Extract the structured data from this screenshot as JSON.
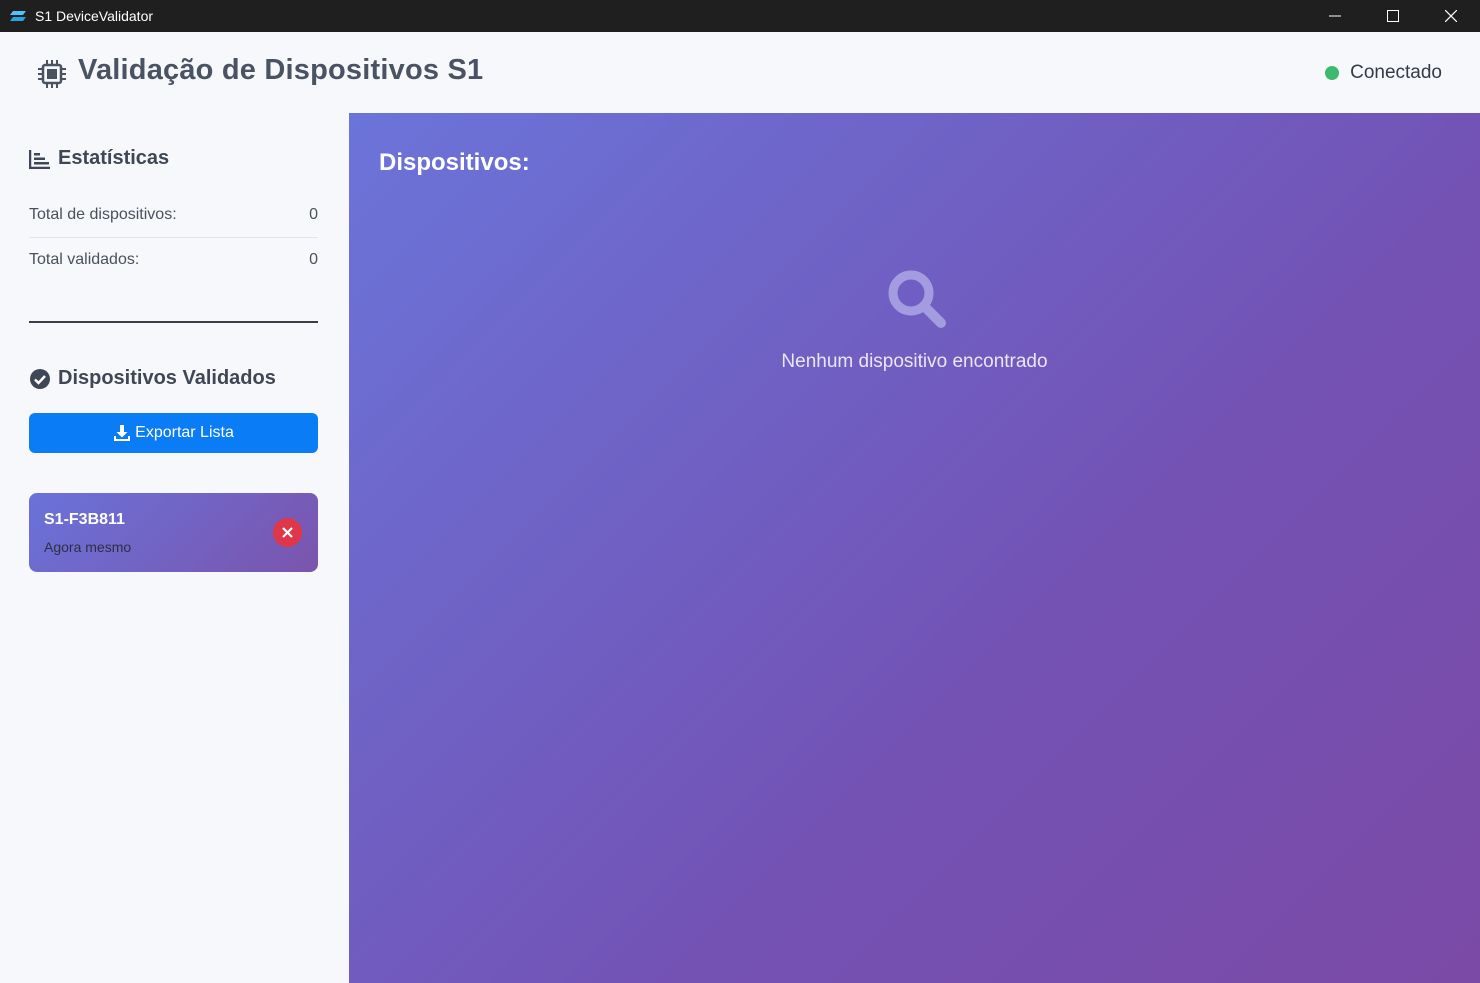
{
  "window": {
    "title": "S1 DeviceValidator",
    "controls": [
      "minimize-icon",
      "maximize-icon",
      "close-icon"
    ]
  },
  "header": {
    "icon": "chip-icon",
    "title": "Validação de Dispositivos S1",
    "status_label": "Conectado",
    "status_color": "#3dba6f"
  },
  "sidebar": {
    "stats": {
      "icon": "bar-chart-icon",
      "title": "Estatísticas",
      "rows": [
        {
          "label": "Total de dispositivos:",
          "value": "0"
        },
        {
          "label": "Total validados:",
          "value": "0"
        }
      ]
    },
    "validated": {
      "icon": "check-circle-icon",
      "title": "Dispositivos Validados",
      "export_label": "Exportar Lista",
      "export_icon": "download-icon",
      "items": [
        {
          "id": "S1-F3B811",
          "time": "Agora mesmo",
          "remove_icon": "close-icon"
        }
      ]
    }
  },
  "main": {
    "title": "Dispositivos:",
    "empty_icon": "search-icon",
    "empty_text": "Nenhum dispositivo encontrado"
  },
  "colors": {
    "accent": "#0a7cf5",
    "danger": "#e03649",
    "gradient_start": "#6b74d9",
    "gradient_end": "#7b4aa6"
  }
}
